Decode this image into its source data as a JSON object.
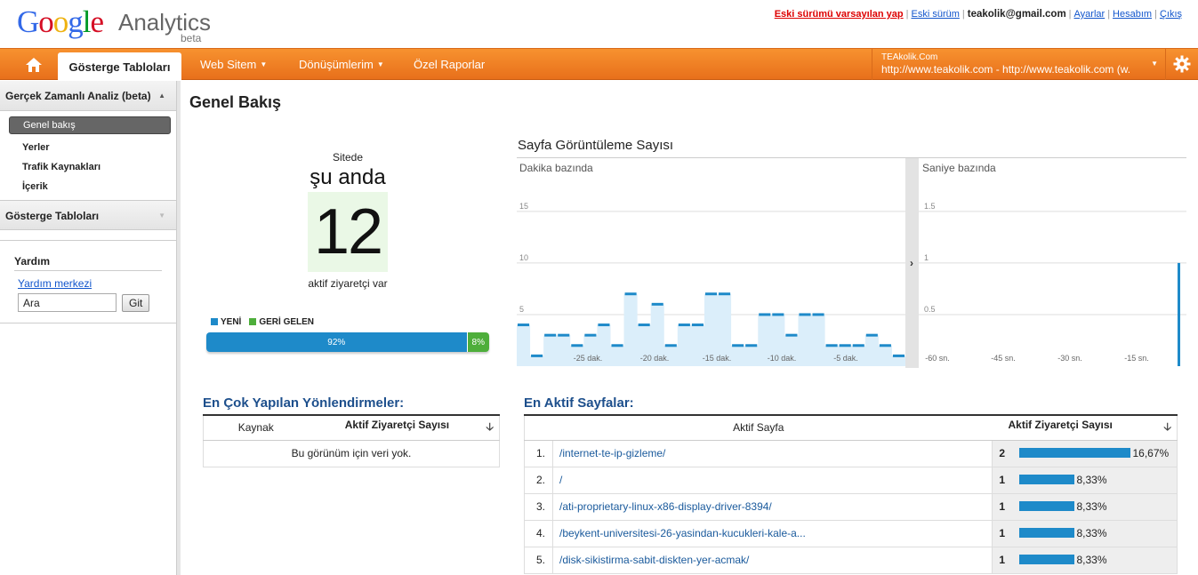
{
  "header": {
    "logo_google": "Google",
    "logo_product": "Analytics",
    "logo_badge": "beta",
    "links": {
      "default_old": "Eski sürümü varsayılan yap",
      "old_version": "Eski sürüm",
      "email": "teakolik@gmail.com",
      "settings": "Ayarlar",
      "account": "Hesabım",
      "logout": "Çıkış"
    }
  },
  "nav": {
    "active_tab": "Gösterge Tabloları",
    "items": [
      "Web Sitem",
      "Dönüşümlerim",
      "Özel Raporlar"
    ],
    "profile_account": "TEAkolik.Com",
    "profile_url": "http://www.teakolik.com - http://www.teakolik.com (w..."
  },
  "sidebar": {
    "realtime_header": "Gerçek Zamanlı Analiz (beta)",
    "realtime_items": [
      "Genel bakış",
      "Yerler",
      "Trafik Kaynakları",
      "İçerik"
    ],
    "dashboards_header": "Gösterge Tabloları",
    "help": {
      "title": "Yardım",
      "center_link": "Yardım merkezi",
      "search_value": "Ara",
      "go_button": "Git"
    }
  },
  "main": {
    "title": "Genel Bakış",
    "visitors": {
      "on_site": "Sitede",
      "right_now": "şu anda",
      "count": "12",
      "label": "aktif ziyaretçi var",
      "legend_new": "YENİ",
      "legend_returning": "GERİ GELEN",
      "new_pct": "92%",
      "returning_pct": "8%",
      "new_fraction": 0.92,
      "returning_fraction": 0.08
    }
  },
  "colors": {
    "new": "#1e8ac9",
    "returning": "#4eae3b",
    "nav_orange": "#f08323",
    "link_blue": "#1a5a9c"
  },
  "chart_data": [
    {
      "type": "bar",
      "title": "Sayfa Görüntüleme Sayısı",
      "subtitle": "Dakika bazında",
      "ylim": [
        0,
        18
      ],
      "yticks": [
        5,
        10,
        15
      ],
      "xtick_labels": [
        "-25 dak.",
        "-20 dak.",
        "-15 dak.",
        "-10 dak.",
        "-5 dak."
      ],
      "values": [
        4,
        1,
        3,
        3,
        2,
        3,
        4,
        2,
        7,
        4,
        6,
        2,
        4,
        4,
        7,
        7,
        2,
        2,
        5,
        5,
        3,
        5,
        5,
        2,
        2,
        2,
        3,
        2,
        1
      ]
    },
    {
      "type": "bar",
      "subtitle": "Saniye bazında",
      "ylim": [
        0,
        1.8
      ],
      "yticks": [
        0.5,
        1,
        1.5
      ],
      "xtick_labels": [
        "-60 sn.",
        "-45 sn.",
        "-30 sn.",
        "-15 sn."
      ],
      "values": [
        1
      ]
    }
  ],
  "referrals": {
    "title": "En Çok Yapılan Yönlendirmeler:",
    "col_source": "Kaynak",
    "col_visitors": "Aktif Ziyaretçi Sayısı",
    "empty_text": "Bu görünüm için veri yok."
  },
  "pages": {
    "title": "En Aktif Sayfalar:",
    "col_page": "Aktif Sayfa",
    "col_visitors": "Aktif Ziyaretçi Sayısı",
    "rows": [
      {
        "rank": "1.",
        "path": "/internet-te-ip-gizleme/",
        "count": "2",
        "pct": "16,67%",
        "fraction": 0.1667
      },
      {
        "rank": "2.",
        "path": "/",
        "count": "1",
        "pct": "8,33%",
        "fraction": 0.0833
      },
      {
        "rank": "3.",
        "path": "/ati-proprietary-linux-x86-display-driver-8394/",
        "count": "1",
        "pct": "8,33%",
        "fraction": 0.0833
      },
      {
        "rank": "4.",
        "path": "/beykent-universitesi-26-yasindan-kucukleri-kale-a...",
        "count": "1",
        "pct": "8,33%",
        "fraction": 0.0833
      },
      {
        "rank": "5.",
        "path": "/disk-sikistirma-sabit-diskten-yer-acmak/",
        "count": "1",
        "pct": "8,33%",
        "fraction": 0.0833
      }
    ]
  }
}
